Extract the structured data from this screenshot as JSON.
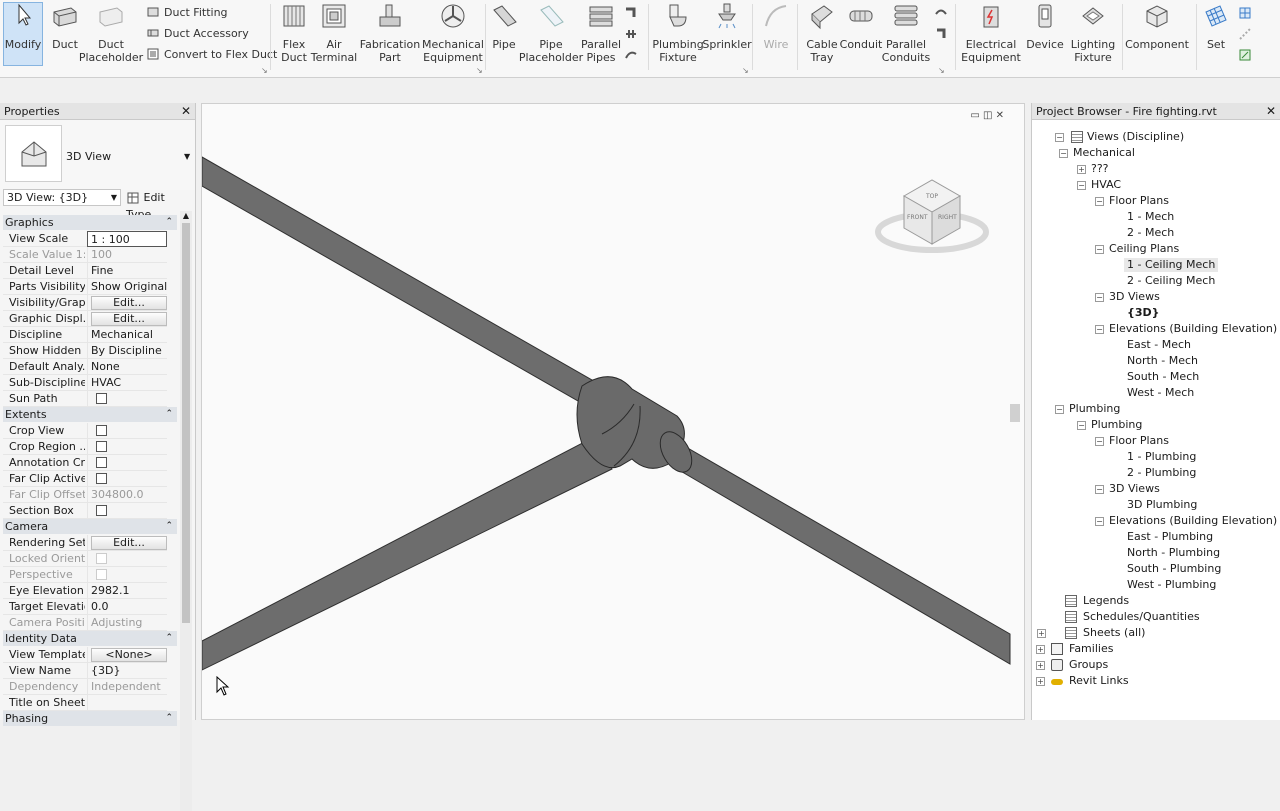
{
  "ribbon": {
    "modify": "Modify",
    "duct": "Duct",
    "duct_placeholder": [
      "Duct",
      "Placeholder"
    ],
    "duct_fitting": "Duct  Fitting",
    "duct_accessory": "Duct  Accessory",
    "convert_flex": "Convert to  Flex Duct",
    "flex_duct": [
      "Flex",
      "Duct"
    ],
    "air_terminal": [
      "Air",
      "Terminal"
    ],
    "fabrication_part": [
      "Fabrication",
      "Part"
    ],
    "mechanical_equipment": [
      "Mechanical",
      "Equipment"
    ],
    "pipe": "Pipe",
    "pipe_placeholder": [
      "Pipe",
      "Placeholder"
    ],
    "parallel_pipes": [
      "Parallel",
      "Pipes"
    ],
    "plumbing_fixture": [
      "Plumbing",
      "Fixture"
    ],
    "sprinkler": "Sprinkler",
    "wire": "Wire",
    "cable_tray": [
      "Cable",
      "Tray"
    ],
    "conduit": "Conduit",
    "parallel_conduits": [
      "Parallel",
      "Conduits"
    ],
    "electrical_equipment": [
      "Electrical",
      "Equipment"
    ],
    "device": "Device",
    "lighting_fixture": [
      "Lighting",
      "Fixture"
    ],
    "component": "Component",
    "set": "Set"
  },
  "properties": {
    "title": "Properties",
    "type_name": "3D View",
    "instance_selector": "3D View: {3D}",
    "edit_type": "Edit Type",
    "groups": {
      "graphics": "Graphics",
      "extents": "Extents",
      "camera": "Camera",
      "identity": "Identity Data",
      "phasing": "Phasing"
    },
    "rows": {
      "view_scale": [
        "View Scale",
        "1 : 100"
      ],
      "scale_value": [
        "Scale Value    1:",
        "100"
      ],
      "detail_level": [
        "Detail Level",
        "Fine"
      ],
      "parts_visibility": [
        "Parts Visibility",
        "Show Original"
      ],
      "vis_graphics": [
        "Visibility/Grap...",
        "Edit..."
      ],
      "graphic_display": [
        "Graphic Displ...",
        "Edit..."
      ],
      "discipline": [
        "Discipline",
        "Mechanical"
      ],
      "show_hidden": [
        "Show Hidden ...",
        "By Discipline"
      ],
      "default_analysis": [
        "Default Analy...",
        "None"
      ],
      "sub_discipline": [
        "Sub-Discipline",
        "HVAC"
      ],
      "sun_path": [
        "Sun Path",
        ""
      ],
      "crop_view": [
        "Crop View",
        ""
      ],
      "crop_region": [
        "Crop Region ...",
        ""
      ],
      "annotation_crop": [
        "Annotation Cr...",
        ""
      ],
      "far_clip_active": [
        "Far Clip Active",
        ""
      ],
      "far_clip_offset": [
        "Far Clip Offset",
        "304800.0"
      ],
      "section_box": [
        "Section Box",
        ""
      ],
      "rendering_settings": [
        "Rendering Set...",
        "Edit..."
      ],
      "locked_orientation": [
        "Locked Orient...",
        ""
      ],
      "perspective": [
        "Perspective",
        ""
      ],
      "eye_elevation": [
        "Eye Elevation",
        "2982.1"
      ],
      "target_elevation": [
        "Target Elevation",
        "0.0"
      ],
      "camera_position": [
        "Camera Positi...",
        "Adjusting"
      ],
      "view_template": [
        "View Template",
        "<None>"
      ],
      "view_name": [
        "View Name",
        "{3D}"
      ],
      "dependency": [
        "Dependency",
        "Independent"
      ],
      "title_on_sheet": [
        "Title on Sheet",
        ""
      ]
    }
  },
  "viewcube": {
    "top": "TOP",
    "front": "FRONT",
    "right": "RIGHT"
  },
  "browser": {
    "title": "Project Browser - Fire fighting.rvt",
    "nodes": [
      "Views (Discipline)",
      "Mechanical",
      "???",
      "HVAC",
      "Floor Plans",
      "1 - Mech",
      "2 - Mech",
      "Ceiling Plans",
      "1 - Ceiling Mech",
      "2 - Ceiling Mech",
      "3D Views",
      "{3D}",
      "Elevations (Building Elevation)",
      "East - Mech",
      "North - Mech",
      "South - Mech",
      "West - Mech",
      "Plumbing",
      "Plumbing",
      "Floor Plans",
      "1 - Plumbing",
      "2 - Plumbing",
      "3D Views",
      "3D Plumbing",
      "Elevations (Building Elevation)",
      "East - Plumbing",
      "North - Plumbing",
      "South - Plumbing",
      "West - Plumbing",
      "Legends",
      "Schedules/Quantities",
      "Sheets (all)",
      "Families",
      "Groups",
      "Revit Links"
    ]
  },
  "colors": {
    "pipe": "#6d6d6d",
    "pipe_edge": "#2f2f2f",
    "selected_bg": "#e8e8e8"
  }
}
